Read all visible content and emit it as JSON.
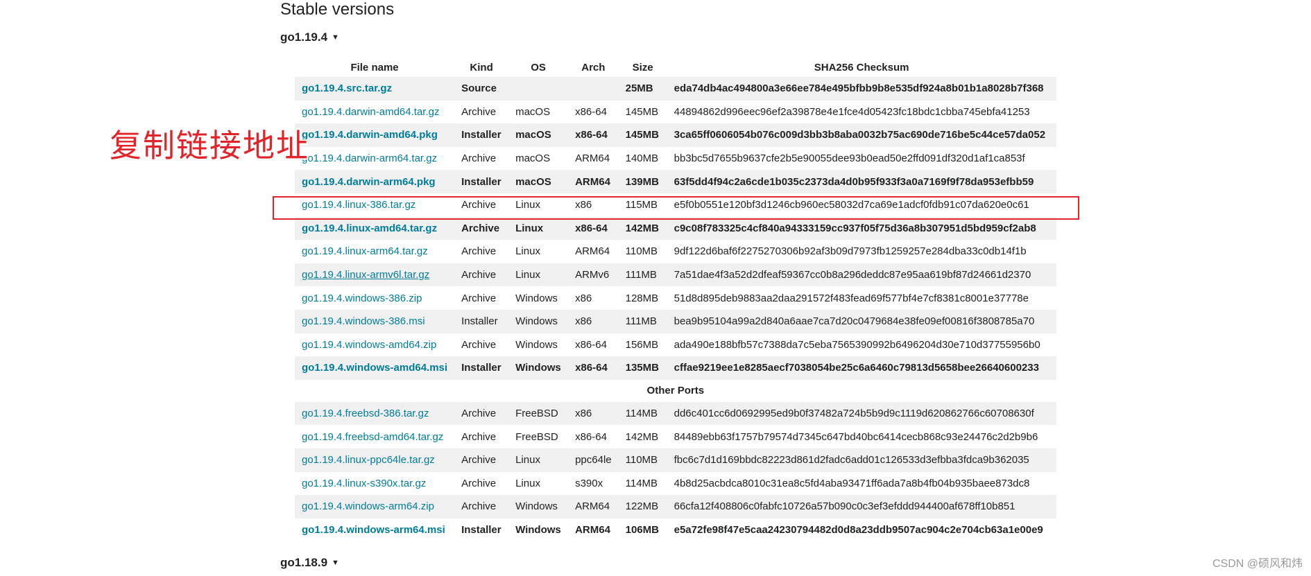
{
  "section_title": "Stable versions",
  "versions": [
    {
      "label": "go1.19.4",
      "caret": "▼"
    },
    {
      "label": "go1.18.9",
      "caret": "▼"
    }
  ],
  "table": {
    "headers": [
      "File name",
      "Kind",
      "OS",
      "Arch",
      "Size",
      "SHA256 Checksum"
    ],
    "primary_rows": [
      {
        "file": "go1.19.4.src.tar.gz",
        "kind": "Source",
        "os": "",
        "arch": "",
        "size": "25MB",
        "sha": "eda74db4ac494800a3e66ee784e495bfbb9b8e535df924a8b01b1a8028b7f368",
        "bold": true
      },
      {
        "file": "go1.19.4.darwin-amd64.tar.gz",
        "kind": "Archive",
        "os": "macOS",
        "arch": "x86-64",
        "size": "145MB",
        "sha": "44894862d996eec96ef2a39878e4e1fce4d05423fc18bdc1cbba745ebfa41253",
        "bold": false
      },
      {
        "file": "go1.19.4.darwin-amd64.pkg",
        "kind": "Installer",
        "os": "macOS",
        "arch": "x86-64",
        "size": "145MB",
        "sha": "3ca65ff0606054b076c009d3bb3b8aba0032b75ac690de716be5c44ce57da052",
        "bold": true
      },
      {
        "file": "go1.19.4.darwin-arm64.tar.gz",
        "kind": "Archive",
        "os": "macOS",
        "arch": "ARM64",
        "size": "140MB",
        "sha": "bb3bc5d7655b9637cfe2b5e90055dee93b0ead50e2ffd091df320d1af1ca853f",
        "bold": false
      },
      {
        "file": "go1.19.4.darwin-arm64.pkg",
        "kind": "Installer",
        "os": "macOS",
        "arch": "ARM64",
        "size": "139MB",
        "sha": "63f5dd4f94c2a6cde1b035c2373da4d0b95f933f3a0a7169f9f78da953efbb59",
        "bold": true
      },
      {
        "file": "go1.19.4.linux-386.tar.gz",
        "kind": "Archive",
        "os": "Linux",
        "arch": "x86",
        "size": "115MB",
        "sha": "e5f0b0551e120bf3d1246cb960ec58032d7ca69e1adcf0fdb91c07da620e0c61",
        "bold": false
      },
      {
        "file": "go1.19.4.linux-amd64.tar.gz",
        "kind": "Archive",
        "os": "Linux",
        "arch": "x86-64",
        "size": "142MB",
        "sha": "c9c08f783325c4cf840a94333159cc937f05f75d36a8b307951d5bd959cf2ab8",
        "bold": true
      },
      {
        "file": "go1.19.4.linux-arm64.tar.gz",
        "kind": "Archive",
        "os": "Linux",
        "arch": "ARM64",
        "size": "110MB",
        "sha": "9df122d6baf6f2275270306b92af3b09d7973fb1259257e284dba33c0db14f1b",
        "bold": false
      },
      {
        "file": "go1.19.4.linux-armv6l.tar.gz",
        "kind": "Archive",
        "os": "Linux",
        "arch": "ARMv6",
        "size": "111MB",
        "sha": "7a51dae4f3a52d2dfeaf59367cc0b8a296deddc87e95aa619bf87d24661d2370",
        "bold": false,
        "underline": true
      },
      {
        "file": "go1.19.4.windows-386.zip",
        "kind": "Archive",
        "os": "Windows",
        "arch": "x86",
        "size": "128MB",
        "sha": "51d8d895deb9883aa2daa291572f483fead69f577bf4e7cf8381c8001e37778e",
        "bold": false
      },
      {
        "file": "go1.19.4.windows-386.msi",
        "kind": "Installer",
        "os": "Windows",
        "arch": "x86",
        "size": "111MB",
        "sha": "bea9b95104a99a2d840a6aae7ca7d20c0479684e38fe09ef00816f3808785a70",
        "bold": false
      },
      {
        "file": "go1.19.4.windows-amd64.zip",
        "kind": "Archive",
        "os": "Windows",
        "arch": "x86-64",
        "size": "156MB",
        "sha": "ada490e188bfb57c7388da7c5eba7565390992b6496204d30e710d37755956b0",
        "bold": false
      },
      {
        "file": "go1.19.4.windows-amd64.msi",
        "kind": "Installer",
        "os": "Windows",
        "arch": "x86-64",
        "size": "135MB",
        "sha": "cffae9219ee1e8285aecf7038054be25c6a6460c79813d5658bee26640600233",
        "bold": true
      }
    ],
    "other_ports_label": "Other Ports",
    "other_rows": [
      {
        "file": "go1.19.4.freebsd-386.tar.gz",
        "kind": "Archive",
        "os": "FreeBSD",
        "arch": "x86",
        "size": "114MB",
        "sha": "dd6c401cc6d0692995ed9b0f37482a724b5b9d9c1119d620862766c60708630f",
        "bold": false
      },
      {
        "file": "go1.19.4.freebsd-amd64.tar.gz",
        "kind": "Archive",
        "os": "FreeBSD",
        "arch": "x86-64",
        "size": "142MB",
        "sha": "84489ebb63f1757b79574d7345c647bd40bc6414cecb868c93e24476c2d2b9b6",
        "bold": false
      },
      {
        "file": "go1.19.4.linux-ppc64le.tar.gz",
        "kind": "Archive",
        "os": "Linux",
        "arch": "ppc64le",
        "size": "110MB",
        "sha": "fbc6c7d1d169bbdc82223d861d2fadc6add01c126533d3efbba3fdca9b362035",
        "bold": false
      },
      {
        "file": "go1.19.4.linux-s390x.tar.gz",
        "kind": "Archive",
        "os": "Linux",
        "arch": "s390x",
        "size": "114MB",
        "sha": "4b8d25acbdca8010c31ea8c5fd4aba93471ff6ada7a8b4fb04b935baee873dc8",
        "bold": false
      },
      {
        "file": "go1.19.4.windows-arm64.zip",
        "kind": "Archive",
        "os": "Windows",
        "arch": "ARM64",
        "size": "122MB",
        "sha": "66cfa12f408806c0fabfc10726a57b090c0c3ef3efddd944400af678ff10b851",
        "bold": false
      },
      {
        "file": "go1.19.4.windows-arm64.msi",
        "kind": "Installer",
        "os": "Windows",
        "arch": "ARM64",
        "size": "106MB",
        "sha": "e5a72fe98f47e5caa24230794482d0d8a23ddb9507ac904c2e704cb63a1e00e9",
        "bold": true
      }
    ]
  },
  "annotation": "复制链接地址",
  "watermark": "CSDN @硕风和炜",
  "colors": {
    "link": "#007d9c",
    "highlight": "#e0242a",
    "row_stripe": "#f0f0f0"
  }
}
